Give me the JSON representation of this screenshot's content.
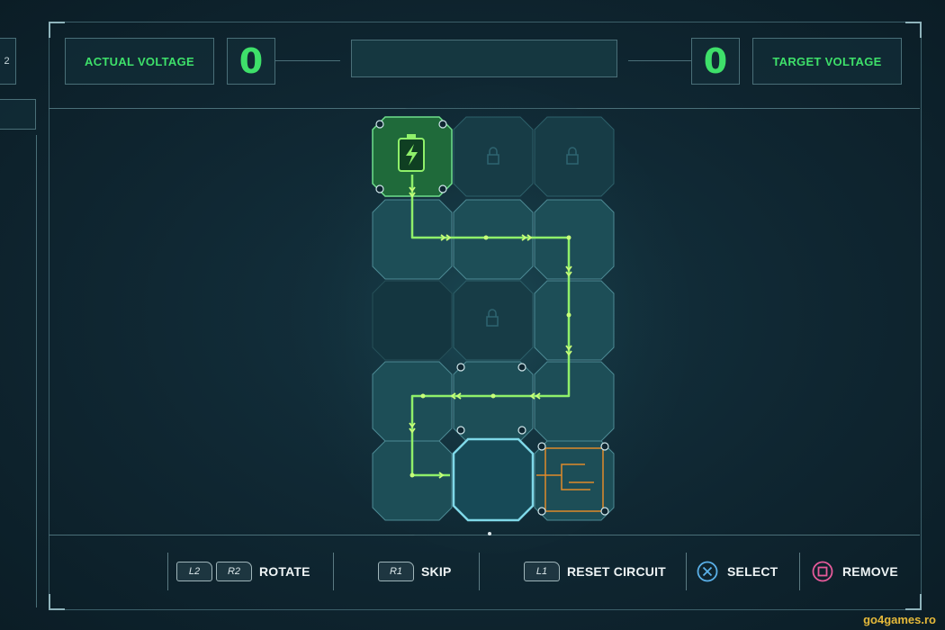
{
  "hud": {
    "actual_voltage_label": "ACTUAL VOLTAGE",
    "actual_voltage_value": "0",
    "target_voltage_label": "TARGET VOLTAGE",
    "target_voltage_value": "0",
    "left_stub": "2"
  },
  "controls": [
    {
      "keys": [
        "L2",
        "R2"
      ],
      "label": "ROTATE"
    },
    {
      "keys": [
        "R1"
      ],
      "label": "SKIP"
    },
    {
      "keys": [
        "L1"
      ],
      "label": "RESET CIRCUIT"
    },
    {
      "icon": "cross-button-icon",
      "label": "SELECT"
    },
    {
      "icon": "square-button-icon",
      "label": "REMOVE"
    }
  ],
  "colors": {
    "accent_green": "#3ee06a",
    "circuit_line": "#8ff06a",
    "tile_teal": "#1f4e57",
    "orange_tile": "#e08a2a",
    "cross_blue": "#5ab0e8",
    "square_pink": "#e55a9a"
  },
  "watermark": "go4games.ro"
}
